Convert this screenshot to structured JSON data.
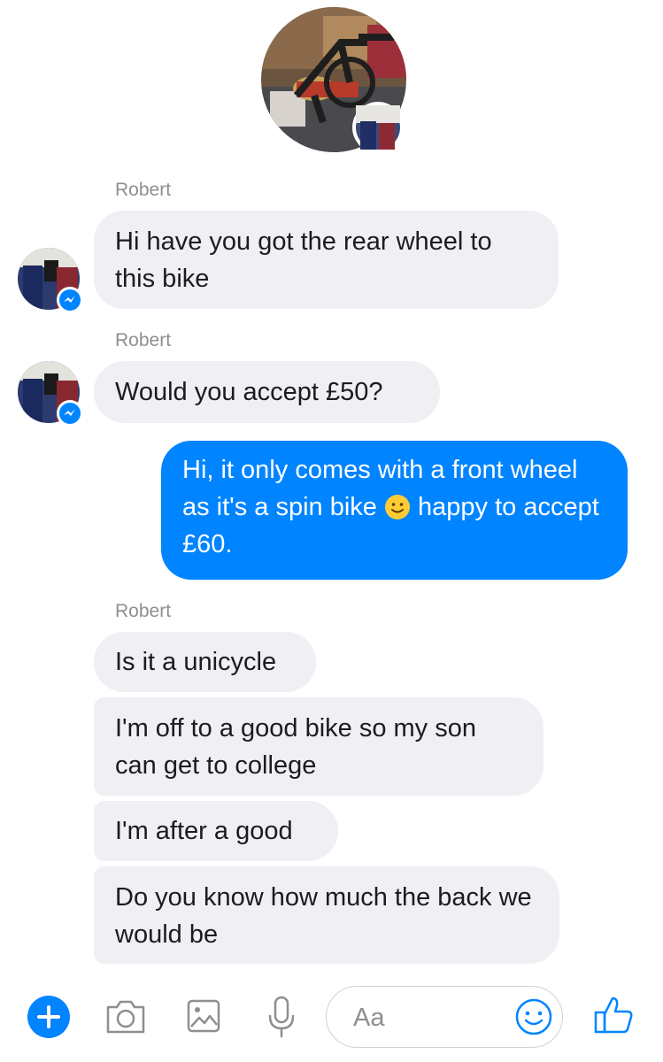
{
  "thread": {
    "header_photo": "bike-photo",
    "messages": [
      {
        "sender": "Robert",
        "text": "Hi have you got the rear wheel to this bike"
      },
      {
        "sender": "Robert",
        "text": "Would you accept £50?"
      },
      {
        "sender": "me",
        "text_before": "Hi, it only comes with a front wheel as it's a spin bike",
        "emoji": "slightly-smiling-face",
        "text_after": "happy to accept £60."
      },
      {
        "sender": "Robert",
        "text": "Is it a unicycle"
      },
      {
        "sender": "Robert",
        "text": "I'm off to a good bike so my son can get to college"
      },
      {
        "sender": "Robert",
        "text": "I'm after a good"
      },
      {
        "sender": "Robert",
        "text": "Do you know how much the back we would be"
      }
    ],
    "sender_labels": [
      "Robert",
      "Robert",
      "Robert"
    ]
  },
  "composer": {
    "placeholder": "Aa",
    "icons": [
      "plus-icon",
      "camera-icon",
      "image-icon",
      "microphone-icon",
      "emoji-icon",
      "thumbs-up-icon"
    ]
  },
  "colors": {
    "accent": "#0084ff",
    "incoming_bubble": "#efeff4",
    "secondary_text": "#8e8e93"
  }
}
